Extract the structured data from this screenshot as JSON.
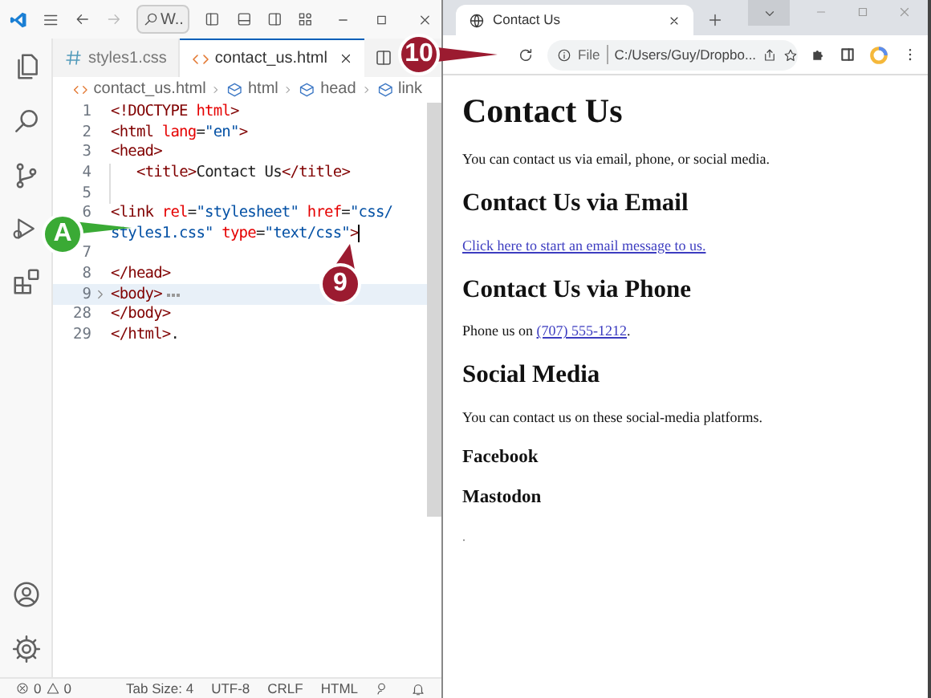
{
  "editor": {
    "command_center": "W..",
    "tabs": [
      {
        "label": "styles1.css",
        "selected": false
      },
      {
        "label": "contact_us.html",
        "selected": true
      }
    ],
    "breadcrumbs": [
      {
        "label": "contact_us.html"
      },
      {
        "label": "html"
      },
      {
        "label": "head"
      },
      {
        "label": "link"
      }
    ],
    "lines": [
      {
        "number": "1",
        "tokens": [
          {
            "kind": "tag",
            "text": "<!DOCTYPE "
          },
          {
            "kind": "attr",
            "text": "html"
          },
          {
            "kind": "tag",
            "text": ">"
          }
        ]
      },
      {
        "number": "2",
        "tokens": [
          {
            "kind": "tag",
            "text": "<html "
          },
          {
            "kind": "attr",
            "text": "lang"
          },
          {
            "kind": "text",
            "text": "="
          },
          {
            "kind": "string",
            "text": "\"en\""
          },
          {
            "kind": "tag",
            "text": ">"
          }
        ]
      },
      {
        "number": "3",
        "tokens": [
          {
            "kind": "tag",
            "text": "<head>"
          }
        ]
      },
      {
        "number": "4",
        "indent": true,
        "tokens": [
          {
            "kind": "tag",
            "text": "<title>"
          },
          {
            "kind": "text",
            "text": "Contact Us"
          },
          {
            "kind": "tag",
            "text": "</title>"
          }
        ]
      },
      {
        "number": "5",
        "indent": true
      },
      {
        "number": "6",
        "tokens": [
          {
            "kind": "tag",
            "text": "<link "
          },
          {
            "kind": "attr",
            "text": "rel"
          },
          {
            "kind": "text",
            "text": "="
          },
          {
            "kind": "string",
            "text": "\"stylesheet\" "
          },
          {
            "kind": "attr",
            "text": "href"
          },
          {
            "kind": "text",
            "text": "="
          },
          {
            "kind": "string",
            "text": "\"css/"
          }
        ]
      },
      {
        "cursor": true,
        "tokens": [
          {
            "kind": "string",
            "text": "styles1.css\" "
          },
          {
            "kind": "attr",
            "text": "type"
          },
          {
            "kind": "text",
            "text": "="
          },
          {
            "kind": "string",
            "text": "\"text/css\""
          },
          {
            "kind": "tag",
            "text": ">"
          }
        ]
      },
      {
        "number": "7"
      },
      {
        "number": "8",
        "tokens": [
          {
            "kind": "tag",
            "text": "</head>"
          }
        ]
      },
      {
        "number": "9",
        "folded": true,
        "highlighted": true,
        "tokens": [
          {
            "kind": "tag",
            "text": "<body>"
          }
        ]
      },
      {
        "number": "28",
        "tokens": [
          {
            "kind": "tag",
            "text": "</body>"
          }
        ]
      },
      {
        "number": "29",
        "tokens": [
          {
            "kind": "tag",
            "text": "</html>"
          },
          {
            "kind": "text",
            "text": "."
          }
        ]
      }
    ],
    "status": {
      "errors": "0",
      "warnings": "0",
      "items": [
        "Tab Size: 4",
        "UTF-8",
        "CRLF",
        "HTML"
      ]
    }
  },
  "browser": {
    "tab": "Contact Us",
    "address_label": "File",
    "address": "C:/Users/Guy/Dropbo...",
    "content": [
      {
        "kind": "h1",
        "text": "Contact Us"
      },
      {
        "kind": "p",
        "text": "You can contact us via email, phone, or social media."
      },
      {
        "kind": "h2",
        "text": "Contact Us via Email"
      },
      {
        "kind": "link",
        "text": "Click here to start an email message to us."
      },
      {
        "kind": "h2",
        "text": "Contact Us via Phone"
      },
      {
        "kind": "p",
        "text": "Phone us on ",
        "link": "(707) 555-1212",
        "after": "."
      },
      {
        "kind": "h2",
        "text": "Social Media"
      },
      {
        "kind": "p",
        "text": "You can contact us on these social-media platforms."
      },
      {
        "kind": "h3",
        "text": "Facebook"
      },
      {
        "kind": "h3",
        "text": "Mastodon"
      },
      {
        "kind": "small",
        "text": "."
      }
    ]
  },
  "callouts": [
    {
      "label": "10",
      "color": "#9b1b30"
    },
    {
      "label": "A",
      "color": "#3aaa35"
    },
    {
      "label": "9",
      "color": "#9b1b30"
    }
  ]
}
